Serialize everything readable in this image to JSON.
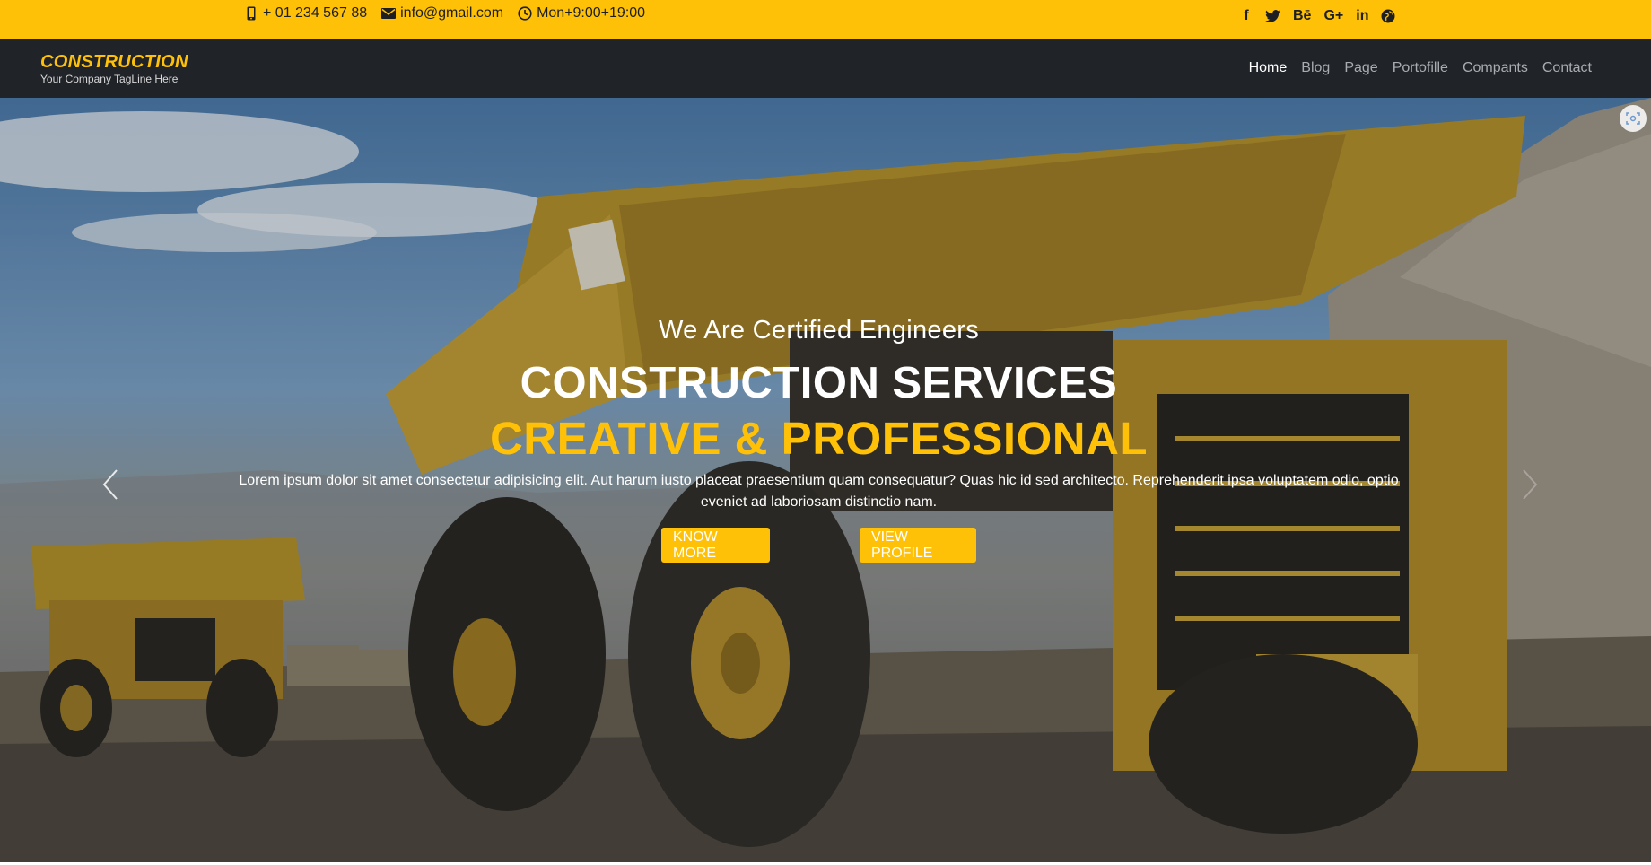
{
  "topbar": {
    "phone": "+ 01 234 567 88",
    "email": "info@gmail.com",
    "hours": "Mon+9:00+19:00",
    "social_icons": [
      "facebook-icon",
      "twitter-icon",
      "behance-icon",
      "google-plus-icon",
      "linkedin-icon",
      "globe-icon"
    ],
    "social_glyphs": [
      "f",
      "t",
      "Bē",
      "G+",
      "in",
      "⊕"
    ]
  },
  "navbar": {
    "logo_name": "CONSTRUCTION",
    "logo_tagline": "Your Company TagLine Here",
    "menu": [
      "Home",
      "Blog",
      "Page",
      "Portofille",
      "Compants",
      "Contact"
    ],
    "active": "Home"
  },
  "hero": {
    "subtitle": "We Are Certified Engineers",
    "title_line1": "CONSTRUCTION SERVICES",
    "title_line2": "CREATIVE & PROFESSIONAL",
    "paragraph": "Lorem ipsum dolor sit amet consectetur adipisicing elit. Aut harum iusto placeat praesentium quam consequatur? Quas hic id sed architecto. Reprehenderit ipsa voluptatem odio, optio eveniet ad laboriosam distinctio nam.",
    "button_know_more": "KNOW MORE",
    "button_view_profile": "VIEW PROFILE"
  },
  "colors": {
    "accent": "#ffc107",
    "navbar_bg": "#202328",
    "text_dark": "#1d1f22"
  }
}
